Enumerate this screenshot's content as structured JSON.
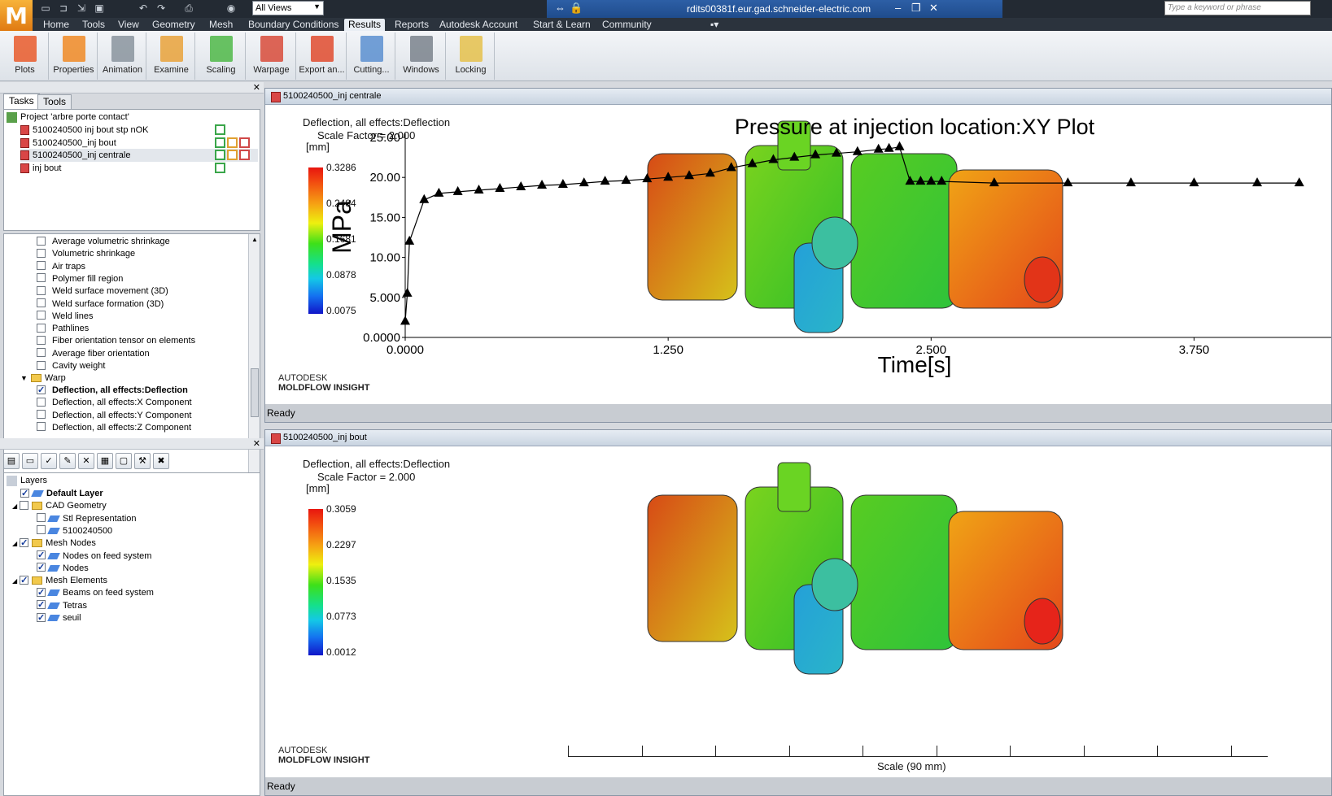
{
  "app": {
    "logo": "M",
    "views_label": "All Views",
    "host": "rdits00381f.eur.gad.schneider-electric.com",
    "search_placeholder": "Type a keyword or phrase"
  },
  "menu": [
    "Home",
    "Tools",
    "View",
    "Geometry",
    "Mesh",
    "Boundary Conditions",
    "Results",
    "Reports",
    "Autodesk Account",
    "Start & Learn",
    "Community"
  ],
  "ribbon": [
    {
      "label": "Plots",
      "icon": "plots-icon",
      "color": "#e95b2a"
    },
    {
      "label": "Properties",
      "icon": "properties-icon",
      "color": "#f08a24"
    },
    {
      "label": "Animation",
      "icon": "animation-icon",
      "color": "#8a949e"
    },
    {
      "label": "Examine",
      "icon": "examine-icon",
      "color": "#e9a23a"
    },
    {
      "label": "Scaling",
      "icon": "scaling-icon",
      "color": "#4fb848"
    },
    {
      "label": "Warpage",
      "icon": "warpage-icon",
      "color": "#d84b3a"
    },
    {
      "label": "Export an...",
      "icon": "export-icon",
      "color": "#e04b2e"
    },
    {
      "label": "Cutting...",
      "icon": "cutting-icon",
      "color": "#5b8fd0"
    },
    {
      "label": "Windows",
      "icon": "windows-icon",
      "color": "#7a828c"
    },
    {
      "label": "Locking",
      "icon": "locking-icon",
      "color": "#e5c14b"
    }
  ],
  "tasks": {
    "tabs": [
      "Tasks",
      "Tools"
    ],
    "project": "Project 'arbre porte contact'",
    "studies": [
      "5100240500 inj bout stp nOK",
      "5100240500_inj bout",
      "5100240500_inj centrale",
      "inj bout"
    ]
  },
  "results": [
    "Average volumetric shrinkage",
    "Volumetric shrinkage",
    "Air traps",
    "Polymer fill region",
    "Weld surface movement (3D)",
    "Weld surface formation (3D)",
    "Weld lines",
    "Pathlines",
    "Fiber orientation tensor on elements",
    "Average fiber orientation",
    "Cavity weight"
  ],
  "warp": {
    "folder": "Warp",
    "items": [
      "Deflection, all effects:Deflection",
      "Deflection, all effects:X Component",
      "Deflection, all effects:Y Component",
      "Deflection, all effects:Z Component"
    ]
  },
  "layers": {
    "root": "Layers",
    "items": [
      {
        "label": "Default Layer",
        "type": "layer",
        "checked": true,
        "bold": true
      },
      {
        "label": "CAD Geometry",
        "type": "folder",
        "checked": false
      },
      {
        "label": "Stl Representation",
        "type": "layer",
        "checked": false
      },
      {
        "label": "5100240500",
        "type": "layer",
        "checked": false
      },
      {
        "label": "Mesh Nodes",
        "type": "folder",
        "checked": true
      },
      {
        "label": "Nodes on feed system",
        "type": "layer",
        "checked": true
      },
      {
        "label": "Nodes",
        "type": "layer",
        "checked": true
      },
      {
        "label": "Mesh Elements",
        "type": "folder",
        "checked": true
      },
      {
        "label": "Beams on feed system",
        "type": "layer",
        "checked": true
      },
      {
        "label": "Tetras",
        "type": "layer",
        "checked": true
      },
      {
        "label": "seuil",
        "type": "layer",
        "checked": true
      }
    ]
  },
  "view_top": {
    "tab": "5100240500_inj centrale",
    "result": "Deflection, all effects:Deflection",
    "scale_factor": "Scale Factor = 2.000",
    "unit": "[mm]",
    "legend": [
      "0.3286",
      "0.2484",
      "0.1681",
      "0.0878",
      "0.0075"
    ],
    "status": "Ready",
    "brand1": "AUTODESK",
    "brand2": "MOLDFLOW INSIGHT"
  },
  "view_bottom": {
    "tab": "5100240500_inj bout",
    "result": "Deflection, all effects:Deflection",
    "scale_factor": "Scale Factor = 2.000",
    "unit": "[mm]",
    "legend": [
      "0.3059",
      "0.2297",
      "0.1535",
      "0.0773",
      "0.0012"
    ],
    "status": "Ready",
    "brand1": "AUTODESK",
    "brand2": "MOLDFLOW INSIGHT",
    "scale_label": "Scale (90 mm)"
  },
  "chart_data": {
    "type": "line",
    "title": "Pressure at injection location:XY Plot",
    "xlabel": "Time[s]",
    "ylabel": "MPa",
    "xticks": [
      "0.0000",
      "1.250",
      "2.500",
      "3.750"
    ],
    "yticks": [
      "0.0000",
      "5.000",
      "10.00",
      "15.00",
      "20.00",
      "25.00"
    ],
    "xlim": [
      0,
      4.75
    ],
    "ylim": [
      0,
      25
    ],
    "x": [
      0,
      0.01,
      0.02,
      0.09,
      0.16,
      0.25,
      0.35,
      0.45,
      0.55,
      0.65,
      0.75,
      0.85,
      0.95,
      1.05,
      1.15,
      1.25,
      1.35,
      1.45,
      1.55,
      1.65,
      1.75,
      1.85,
      1.95,
      2.05,
      2.15,
      2.25,
      2.3,
      2.35,
      2.4,
      2.45,
      2.5,
      2.55,
      2.8,
      3.15,
      3.45,
      3.75,
      4.05,
      4.25
    ],
    "y": [
      2,
      5.5,
      12,
      17.2,
      18,
      18.2,
      18.4,
      18.6,
      18.8,
      19,
      19.1,
      19.3,
      19.5,
      19.6,
      19.8,
      20,
      20.2,
      20.5,
      21.2,
      21.7,
      22.2,
      22.5,
      22.8,
      23,
      23.2,
      23.5,
      23.6,
      23.8,
      19.5,
      19.5,
      19.5,
      19.5,
      19.3,
      19.3,
      19.3,
      19.3,
      19.3,
      19.3
    ]
  }
}
